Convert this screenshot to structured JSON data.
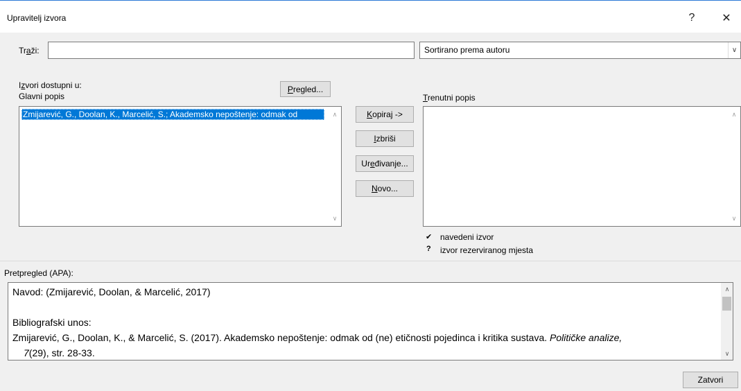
{
  "window": {
    "title": "Upravitelj izvora",
    "help_glyph": "?",
    "close_glyph": "✕"
  },
  "search": {
    "label_pre": "Tr",
    "label_accel": "a",
    "label_post": "ži:",
    "value": ""
  },
  "sort": {
    "selected": "Sortirano prema autoru",
    "arrow": "∨"
  },
  "sources": {
    "label_line1_pre": "I",
    "label_line1_accel": "z",
    "label_line1_post": "vori dostupni u:",
    "label_line2": "Glavni popis",
    "browse_accel": "P",
    "browse_rest": "regled...",
    "items": [
      "Zmijarević, G., Doolan, K., Marcelić, S.; Akademsko nepoštenje: odmak od"
    ]
  },
  "actions": {
    "copy_accel": "K",
    "copy_rest": "opiraj ->",
    "delete_accel": "I",
    "delete_rest": "zbriši",
    "edit_pre": "Ur",
    "edit_accel": "e",
    "edit_post": "đivanje...",
    "new_accel": "N",
    "new_rest": "ovo..."
  },
  "current": {
    "label_accel": "T",
    "label_rest": "renutni popis",
    "items": []
  },
  "legend": {
    "cited_glyph": "✔",
    "cited_label": "navedeni izvor",
    "placeholder_glyph": "?",
    "placeholder_label": "izvor rezerviranog mjesta"
  },
  "preview": {
    "label": "Pretpregled (APA):",
    "citation": "Navod:  (Zmijarević, Doolan, & Marcelić, 2017)",
    "biblio_heading": "Bibliografski unos:",
    "biblio_text": "Zmijarević, G., Doolan, K., & Marcelić, S. (2017). Akademsko nepoštenje: odmak od (ne) etičnosti pojedinca i kritika sustava. ",
    "biblio_journal": "Političke analize,",
    "biblio_volume": "7",
    "biblio_rest": "(29), str. 28-33."
  },
  "footer": {
    "close_label": "Zatvori"
  }
}
